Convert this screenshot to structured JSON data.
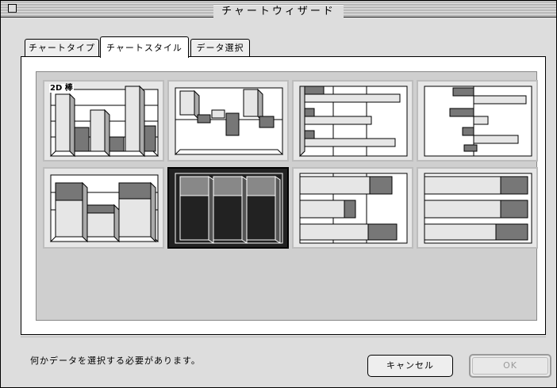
{
  "window": {
    "title": "チャートウィザード"
  },
  "tabs": [
    {
      "label": "チャートタイプ",
      "active": false
    },
    {
      "label": "チャートスタイル",
      "active": true
    },
    {
      "label": "データ選択",
      "active": false
    }
  ],
  "styles": [
    {
      "name": "vertical-bar-2d",
      "badge": "2D 棒",
      "selected": false
    },
    {
      "name": "vertical-bar-floating",
      "badge": "",
      "selected": false
    },
    {
      "name": "horizontal-bar-grouped",
      "badge": "",
      "selected": false
    },
    {
      "name": "horizontal-bar-floating",
      "badge": "",
      "selected": false
    },
    {
      "name": "stacked-bar",
      "badge": "",
      "selected": false
    },
    {
      "name": "stacked-bar-100",
      "badge": "",
      "selected": true
    },
    {
      "name": "horizontal-stacked-bar",
      "badge": "",
      "selected": false
    },
    {
      "name": "horizontal-stacked-bar-100",
      "badge": "",
      "selected": false
    }
  ],
  "status": {
    "message": "何かデータを選択する必要があります。"
  },
  "buttons": {
    "cancel_label": "キャンセル",
    "ok_label": "OK",
    "ok_enabled": false
  }
}
